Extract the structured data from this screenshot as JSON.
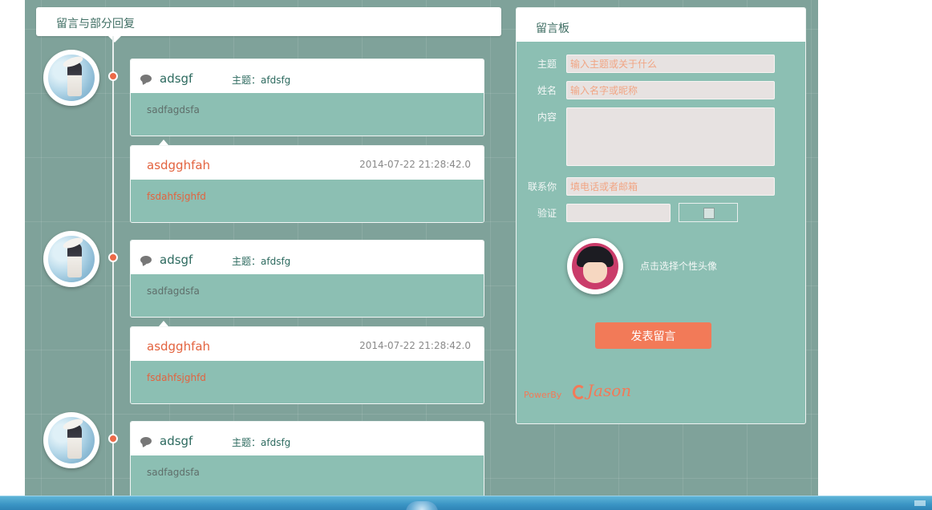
{
  "left_panel": {
    "title": "留言与部分回复"
  },
  "timeline": [
    {
      "message": {
        "author": "adsgf",
        "topic": "主题：afdsfg",
        "content": "sadfagdsfa"
      },
      "reply": {
        "author": "asdgghfah",
        "date": "2014-07-22 21:28:42.0",
        "content": "fsdahfsjghfd"
      }
    },
    {
      "message": {
        "author": "adsgf",
        "topic": "主题：afdsfg",
        "content": "sadfagdsfa"
      },
      "reply": {
        "author": "asdgghfah",
        "date": "2014-07-22 21:28:42.0",
        "content": "fsdahfsjghfd"
      }
    },
    {
      "message": {
        "author": "adsgf",
        "topic": "主题：afdsfg",
        "content": "sadfagdsfa"
      }
    }
  ],
  "form": {
    "title": "留言板",
    "topic_label": "主题",
    "topic_placeholder": "输入主题或关于什么",
    "name_label": "姓名",
    "name_placeholder": "输入名字或昵称",
    "content_label": "内容",
    "contact_label": "联系你",
    "contact_placeholder": "填电话或者邮箱",
    "captcha_label": "验证",
    "avatar_hint": "点击选择个性头像",
    "submit_label": "发表留言",
    "powered_by": "PowerBy",
    "logo_text": "Jason"
  },
  "colors": {
    "board": "#7fa29a",
    "card_body": "#8cbfb3",
    "accent": "#f27a58",
    "author": "#2d6a5f"
  }
}
